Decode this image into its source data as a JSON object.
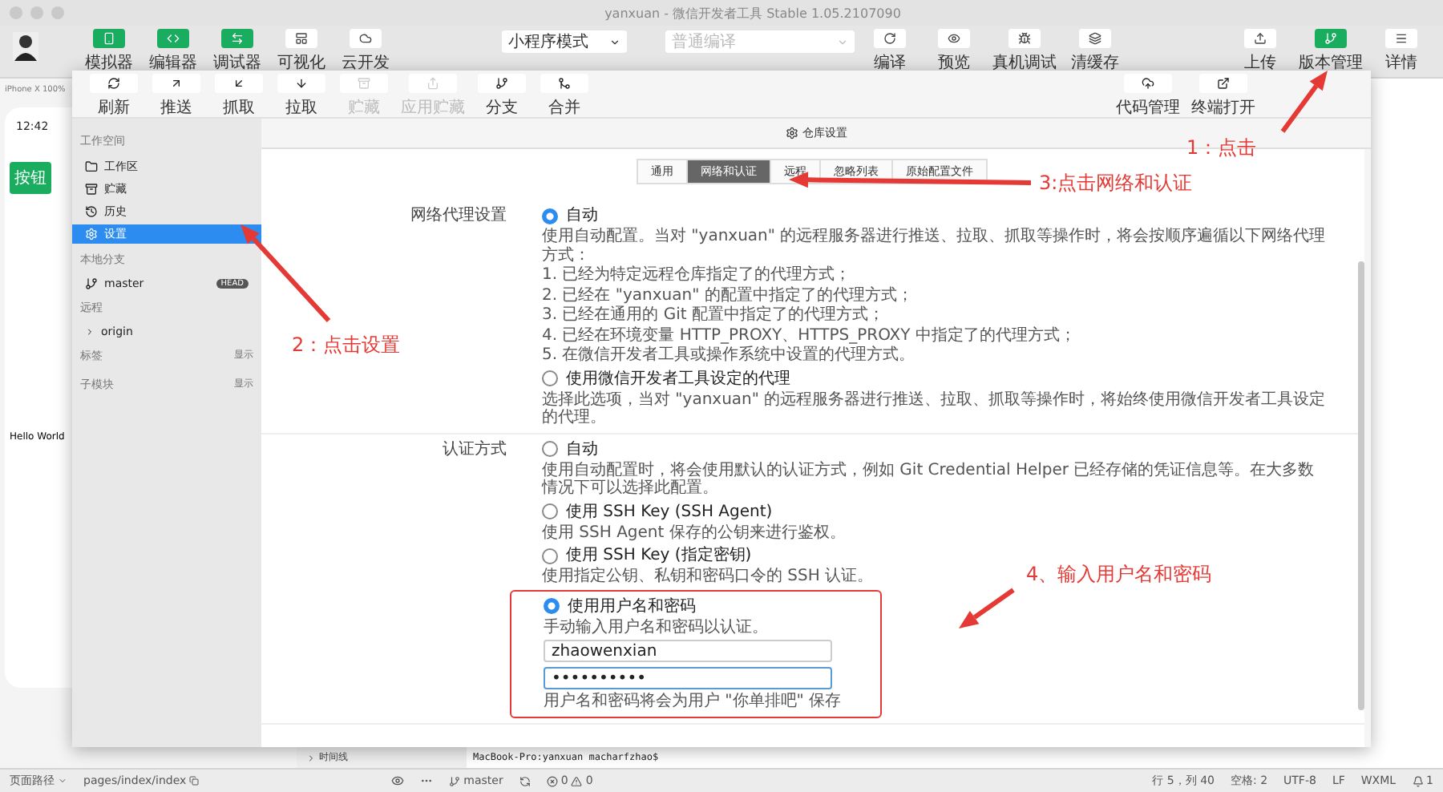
{
  "window": {
    "title": "yanxuan - 微信开发者工具 Stable 1.05.2107090"
  },
  "toolbar": {
    "left_buttons": [
      {
        "label": "模拟器",
        "active": true
      },
      {
        "label": "编辑器",
        "active": true
      },
      {
        "label": "调试器",
        "active": true
      },
      {
        "label": "可视化",
        "active": false
      },
      {
        "label": "云开发",
        "active": false
      }
    ],
    "mode_select": {
      "value": "小程序模式",
      "disabled": false
    },
    "compile_select": {
      "value": "普通编译",
      "disabled": true
    },
    "center_buttons": [
      {
        "label": "编译"
      },
      {
        "label": "预览"
      },
      {
        "label": "真机调试"
      },
      {
        "label": "清缓存"
      }
    ],
    "right_buttons": [
      {
        "label": "上传",
        "active": false
      },
      {
        "label": "版本管理",
        "active": true
      },
      {
        "label": "详情",
        "active": false
      }
    ]
  },
  "simulator": {
    "device": "iPhone X 100%",
    "time": "12:42",
    "button": "按钮",
    "text": "Hello World"
  },
  "repo_window": {
    "toolbar": [
      {
        "label": "刷新",
        "disabled": false
      },
      {
        "label": "推送",
        "disabled": false
      },
      {
        "label": "抓取",
        "disabled": false
      },
      {
        "label": "拉取",
        "disabled": false
      },
      {
        "label": "贮藏",
        "disabled": true
      },
      {
        "label": "应用贮藏",
        "disabled": true
      },
      {
        "label": "分支",
        "disabled": false
      },
      {
        "label": "合并",
        "disabled": false
      }
    ],
    "toolbar_right": [
      {
        "label": "代码管理"
      },
      {
        "label": "终端打开"
      }
    ],
    "sidebar": [
      {
        "heading": "工作空间",
        "items": [
          {
            "label": "工作区",
            "selected": false
          },
          {
            "label": "贮藏",
            "selected": false
          },
          {
            "label": "历史",
            "selected": false
          },
          {
            "label": "设置",
            "selected": true
          }
        ]
      },
      {
        "heading": "本地分支",
        "branches": [
          {
            "name": "master",
            "badge": "HEAD"
          }
        ]
      },
      {
        "heading": "远程",
        "remotes": [
          {
            "name": "origin",
            "expanded": false
          }
        ]
      },
      {
        "heading": "标签",
        "action": "显示"
      },
      {
        "heading": "子模块",
        "action": "显示"
      }
    ],
    "header": "仓库设置",
    "tabs": [
      {
        "label": "通用",
        "selected": false
      },
      {
        "label": "网络和认证",
        "selected": true
      },
      {
        "label": "远程",
        "selected": false
      },
      {
        "label": "忽略列表",
        "selected": false
      },
      {
        "label": "原始配置文件",
        "selected": false
      }
    ],
    "sections": [
      {
        "label": "网络代理设置",
        "options": [
          {
            "label": "自动",
            "selected": true,
            "description": [
              "使用自动配置。当对 \"yanxuan\" 的远程服务器进行推送、拉取、抓取等操作时，将会按顺序遍循以下网络代理方式：",
              "1. 已经为特定远程仓库指定了的代理方式；",
              "2. 已经在 \"yanxuan\" 的配置中指定了的代理方式；",
              "3. 已经在通用的 Git 配置中指定了的代理方式；",
              "4. 已经在环境变量 HTTP_PROXY、HTTPS_PROXY 中指定了的代理方式；",
              "5. 在微信开发者工具或操作系统中设置的代理方式。"
            ]
          },
          {
            "label": "使用微信开发者工具设定的代理",
            "selected": false,
            "description": [
              "选择此选项，当对 \"yanxuan\" 的远程服务器进行推送、拉取、抓取等操作时，将始终使用微信开发者工具设定的代理。"
            ]
          }
        ]
      },
      {
        "label": "认证方式",
        "options": [
          {
            "label": "自动",
            "selected": false,
            "description": [
              "使用自动配置时，将会使用默认的认证方式，例如 Git Credential Helper 已经存储的凭证信息等。在大多数情况下可以选择此配置。"
            ]
          },
          {
            "label": "使用 SSH Key (SSH Agent)",
            "selected": false,
            "description": [
              "使用 SSH Agent 保存的公钥来进行鉴权。"
            ]
          },
          {
            "label": "使用 SSH Key (指定密钥)",
            "selected": false,
            "description": [
              "使用指定公钥、私钥和密码口令的 SSH 认证。"
            ]
          },
          {
            "label": "使用用户名和密码",
            "selected": true,
            "highlighted": true,
            "description": [
              "手动输入用户名和密码以认证。"
            ],
            "fields": [
              {
                "kind": "text",
                "value": "zhaowenxian",
                "focused": false
              },
              {
                "kind": "password",
                "value": "••••••••••",
                "focused": true
              }
            ],
            "note": "用户名和密码将会为用户 \"你单排吧\" 保存"
          }
        ]
      }
    ]
  },
  "timeline": "时间线",
  "terminal": "MacBook-Pro:yanxuan macharfzhao$",
  "status_bar": {
    "left": [
      "页面路径",
      "pages/index/index"
    ],
    "branch": "master",
    "errors": "0",
    "warnings": "0",
    "right": [
      "行 5，列 40",
      "空格: 2",
      "UTF-8",
      "LF",
      "WXML"
    ],
    "notifications": "1"
  },
  "annotations": [
    {
      "text": "1：点击"
    },
    {
      "text": "2：点击设置"
    },
    {
      "text": "3:点击网络和认证"
    },
    {
      "text": "4、输入用户名和密码"
    }
  ]
}
